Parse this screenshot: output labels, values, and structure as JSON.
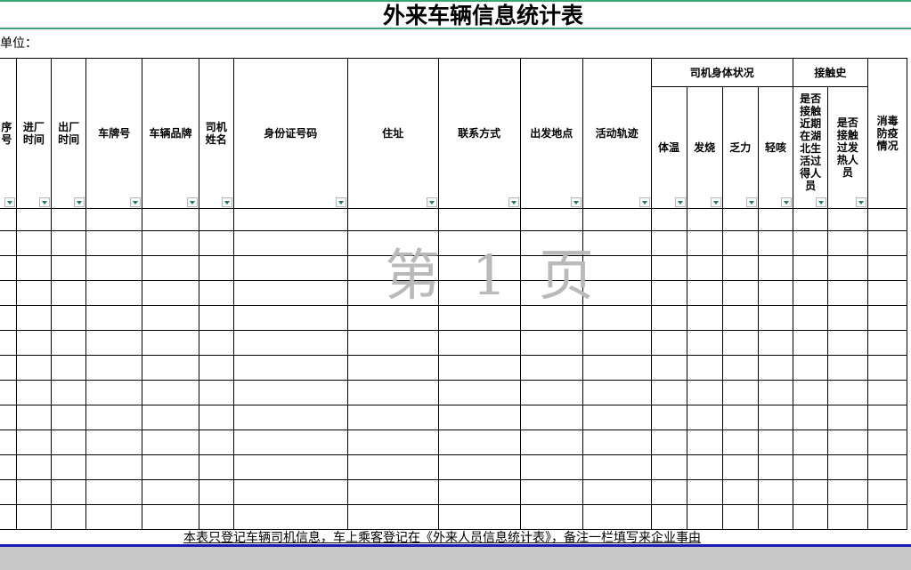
{
  "sheet": {
    "title": "外来车辆信息统计表",
    "unit_label": "单位：",
    "watermark": "第 1 页",
    "footnote": "本表只登记车辆司机信息，车上乘客登记在《外来人员信息统计表》，备注一栏填写来企业事由"
  },
  "headers": {
    "seq": "序号",
    "entry_time": "进厂时间",
    "exit_time": "出厂时间",
    "plate": "车牌号",
    "brand": "车辆品牌",
    "driver_name": "司机姓名",
    "id_number": "身份证号码",
    "address": "住址",
    "contact": "联系方式",
    "departure": "出发地点",
    "trajectory": "活动轨迹",
    "health_group": "司机身体状况",
    "temperature": "体温",
    "fever": "发烧",
    "fatigue": "乏力",
    "cough": "轻咳",
    "contact_group": "接触史",
    "hubei_contact": "是否接触近期在湖北生活过得人员",
    "fever_contact": "是否接触过发热人员",
    "disinfection": "消毒防疫情况"
  },
  "colors": {
    "accent_green": "#3aa876",
    "footer_blue": "#1c1cb5",
    "watermark_gray": "#b9b9b9",
    "filter_arrow": "#1f7a5a"
  },
  "icons": {
    "filter": "filter-dropdown-icon"
  }
}
